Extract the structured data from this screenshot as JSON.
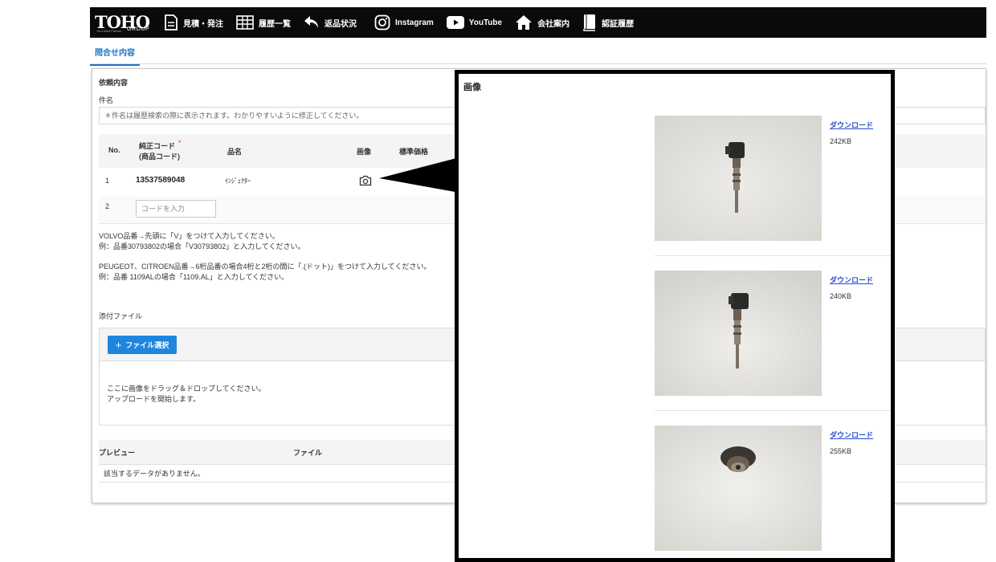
{
  "navbar": {
    "logo_main": "TOHO",
    "logo_sub": "GROUP",
    "logo_tag": "Your Best Partner",
    "items": [
      {
        "label": "見積・発注",
        "icon": "document-icon"
      },
      {
        "label": "履歴一覧",
        "icon": "table-icon"
      },
      {
        "label": "返品状況",
        "icon": "return-arrow-icon"
      },
      {
        "label": "Instagram",
        "icon": "instagram-icon"
      },
      {
        "label": "YouTube",
        "icon": "youtube-icon"
      },
      {
        "label": "会社案内",
        "icon": "home-icon"
      },
      {
        "label": "認証履歴",
        "icon": "book-icon"
      }
    ]
  },
  "tab": {
    "label": "問合せ内容"
  },
  "request": {
    "section_title": "依頼内容",
    "subject_label": "件名",
    "subject_placeholder": "＊件名は履歴検索の際に表示されます。わかりやすいように修正してください。",
    "table": {
      "headers": {
        "no": "No.",
        "code_line1": "純正コード",
        "required_mark": "*",
        "code_line2": "(商品コード)",
        "name": "品名",
        "image": "画像",
        "price": "標準価格"
      },
      "rows": [
        {
          "no": "1",
          "code": "13537589048",
          "name": "ｲﾝｼﾞｪｸﾀｰ"
        },
        {
          "no": "2",
          "code_placeholder": "コードを入力"
        }
      ]
    },
    "notes": [
      "VOLVO品番→先頭に「V」をつけて入力してください。",
      "例：品番30793802の場合「V30793802」と入力してください。",
      "PEUGEOT、CITROEN品番→6桁品番の場合4桁と2桁の間に「.(ドット)」をつけて入力してください。",
      "例：品番 1109ALの場合「1109.AL」と入力してください。"
    ]
  },
  "attachments": {
    "label": "添付ファイル",
    "select_button": "ファイル選択",
    "drop_line1": "ここに画像をドラッグ＆ドロップしてください。",
    "drop_line2": "アップロードを開始します。",
    "preview_header": "プレビュー",
    "file_header": "ファイル",
    "empty_message": "該当するデータがありません。"
  },
  "image_popup": {
    "title": "画像",
    "images": [
      {
        "link": "ダウンロード",
        "size": "242KB"
      },
      {
        "link": "ダウンロード",
        "size": "240KB"
      },
      {
        "link": "ダウンロード",
        "size": "255KB"
      }
    ]
  }
}
